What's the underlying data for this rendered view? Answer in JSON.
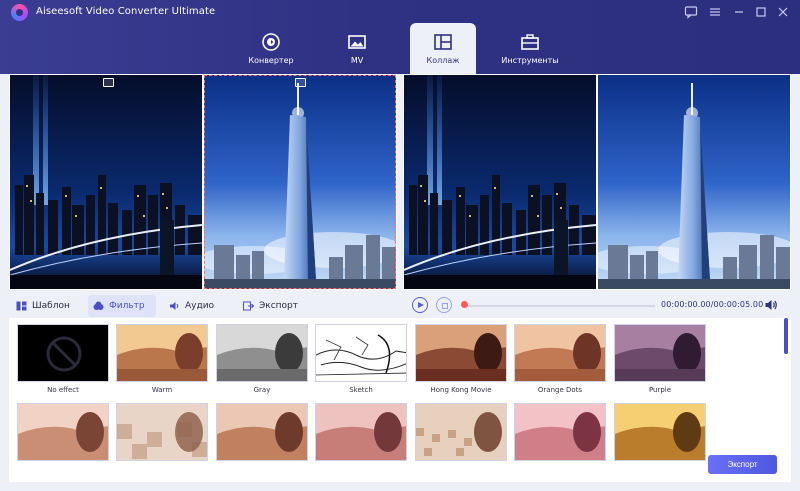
{
  "app": {
    "title": "Aiseesoft Video Converter Ultimate"
  },
  "window_controls": {
    "chat": "feedback-icon",
    "menu": "menu-icon",
    "minimize": "minimize-icon",
    "maximize": "maximize-icon",
    "close": "close-icon"
  },
  "main_tabs": [
    {
      "label": "Конвертер",
      "icon": "convert-icon",
      "active": false
    },
    {
      "label": "MV",
      "icon": "mv-image-icon",
      "active": false
    },
    {
      "label": "Коллаж",
      "icon": "collage-icon",
      "active": true
    },
    {
      "label": "Инструменты",
      "icon": "toolbox-icon",
      "active": false
    }
  ],
  "bottom_tabs": [
    {
      "label": "Шаблон",
      "icon": "template-icon",
      "active": false
    },
    {
      "label": "Фильтр",
      "icon": "filter-icon",
      "active": true
    },
    {
      "label": "Аудио",
      "icon": "audio-icon",
      "active": false
    },
    {
      "label": "Экспорт",
      "icon": "export-icon",
      "active": false
    }
  ],
  "player": {
    "time": "00:00:00.00/00:00:05.00",
    "progress": 0.0
  },
  "filters": {
    "row1": [
      "No effect",
      "Warm",
      "Gray",
      "Sketch",
      "Hong Kong Movie",
      "Orange Dots",
      "Purple"
    ],
    "row2_count_visible": 7
  },
  "export_button": {
    "label": "Экспорт"
  },
  "colors": {
    "accent": "#4a50c4",
    "title_bar": "#2f3183",
    "button": "#5a60ea",
    "selection_dashed": "#ff6b6b"
  }
}
